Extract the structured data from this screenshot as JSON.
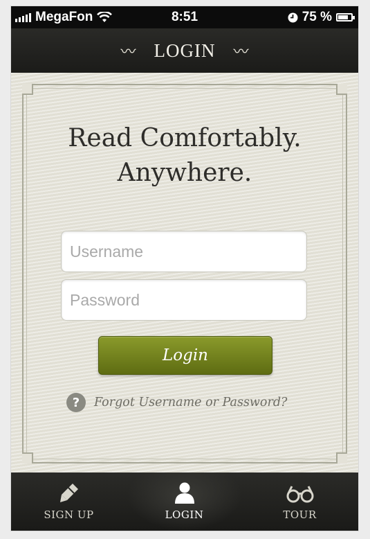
{
  "status_bar": {
    "carrier": "MegaFon",
    "time": "8:51",
    "battery_percent": "75 %",
    "battery_level": 0.75,
    "icons": [
      "signal-icon",
      "wifi-icon",
      "clock-icon",
      "battery-icon"
    ]
  },
  "nav": {
    "title": "LOGIN",
    "left_flourish": "〰",
    "right_flourish": "〰"
  },
  "headline": {
    "line1": "Read Comfortably.",
    "line2": "Anywhere."
  },
  "form": {
    "username_placeholder": "Username",
    "username_value": "",
    "password_placeholder": "Password",
    "password_value": "",
    "login_label": "Login",
    "forgot_label": "Forgot Username or Password?"
  },
  "tabs": [
    {
      "label": "SIGN UP",
      "icon": "pen-icon",
      "active": false
    },
    {
      "label": "LOGIN",
      "icon": "person-icon",
      "active": true
    },
    {
      "label": "TOUR",
      "icon": "glasses-icon",
      "active": false
    }
  ],
  "colors": {
    "accent_button": "#6f7e1c",
    "bar_background": "#1e1e1c",
    "paper": "#e4e2d8"
  }
}
